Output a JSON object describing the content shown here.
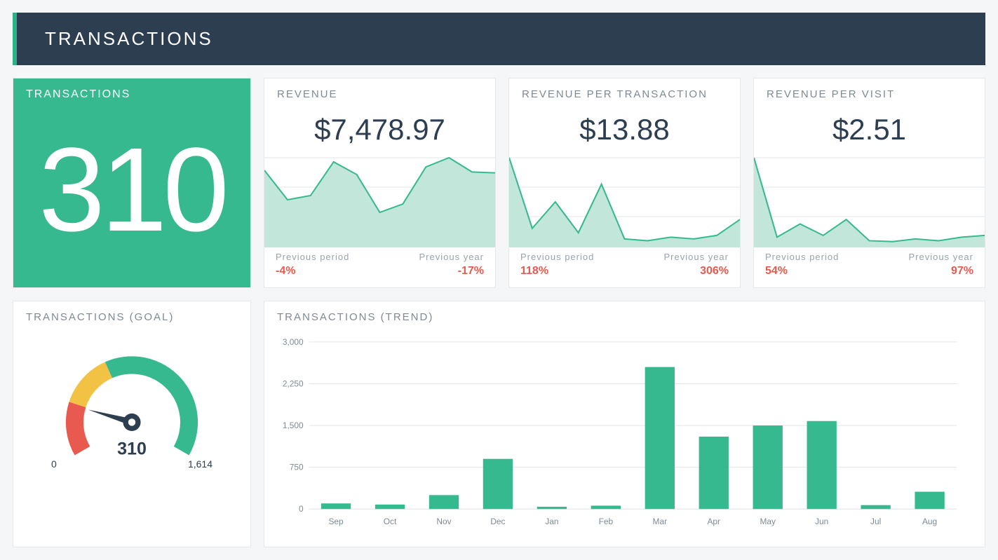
{
  "header": {
    "title": "TRANSACTIONS"
  },
  "tiles": {
    "transactions": {
      "label": "TRANSACTIONS",
      "value": "310"
    },
    "revenue": {
      "label": "REVENUE",
      "value": "$7,478.97",
      "prev_period_lbl": "Previous period",
      "prev_period_val": "-4%",
      "prev_year_lbl": "Previous year",
      "prev_year_val": "-17%"
    },
    "rev_per_txn": {
      "label": "REVENUE PER TRANSACTION",
      "value": "$13.88",
      "prev_period_lbl": "Previous period",
      "prev_period_val": "118%",
      "prev_year_lbl": "Previous year",
      "prev_year_val": "306%"
    },
    "rev_per_visit": {
      "label": "REVENUE PER VISIT",
      "value": "$2.51",
      "prev_period_lbl": "Previous period",
      "prev_period_val": "54%",
      "prev_year_lbl": "Previous year",
      "prev_year_val": "97%"
    }
  },
  "goal": {
    "label": "TRANSACTIONS (GOAL)",
    "value": "310",
    "min": "0",
    "max": "1,614"
  },
  "trend": {
    "label": "TRANSACTIONS (TREND)"
  },
  "chart_data": [
    {
      "id": "revenue_spark",
      "type": "area",
      "values": [
        90,
        55,
        60,
        100,
        85,
        40,
        50,
        94,
        105,
        88,
        87
      ]
    },
    {
      "id": "rev_per_txn_spark",
      "type": "area",
      "values": [
        100,
        20,
        50,
        15,
        70,
        8,
        6,
        10,
        8,
        12,
        30
      ]
    },
    {
      "id": "rev_per_visit_spark",
      "type": "area",
      "values": [
        100,
        10,
        25,
        12,
        30,
        6,
        5,
        8,
        6,
        10,
        12
      ]
    },
    {
      "id": "transactions_goal_gauge",
      "type": "gauge",
      "value": 310,
      "min": 0,
      "max": 1614,
      "zones": [
        {
          "from": 0,
          "to": 323,
          "color": "#e85a4f"
        },
        {
          "from": 323,
          "to": 646,
          "color": "#f1c244"
        },
        {
          "from": 646,
          "to": 1614,
          "color": "#36b98f"
        }
      ]
    },
    {
      "id": "transactions_trend",
      "type": "bar",
      "title": "TRANSACTIONS (TREND)",
      "categories": [
        "Sep",
        "Oct",
        "Nov",
        "Dec",
        "Jan",
        "Feb",
        "Mar",
        "Apr",
        "May",
        "Jun",
        "Jul",
        "Aug"
      ],
      "values": [
        100,
        80,
        250,
        900,
        40,
        60,
        2550,
        1300,
        1500,
        1580,
        70,
        310
      ],
      "ylim": [
        0,
        3000
      ],
      "yticks": [
        0,
        750,
        1500,
        2250,
        3000
      ],
      "xlabel": "",
      "ylabel": ""
    }
  ]
}
